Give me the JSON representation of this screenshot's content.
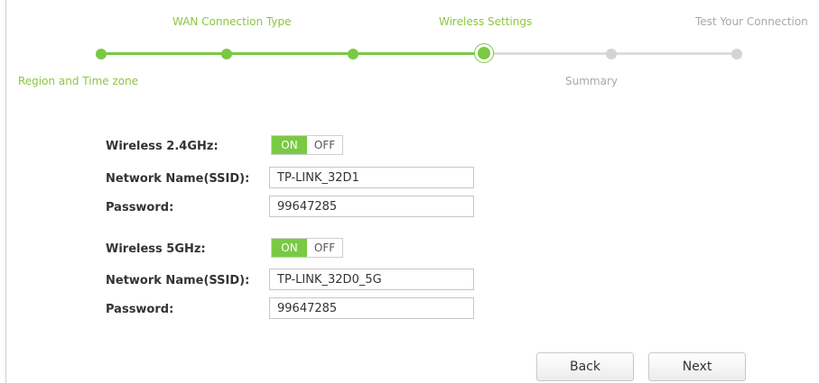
{
  "wizard": {
    "steps": [
      {
        "label": "Region and Time zone",
        "state": "done"
      },
      {
        "label": "WAN Connection Type",
        "state": "done"
      },
      {
        "label": "",
        "state": "done"
      },
      {
        "label": "Wireless Settings",
        "state": "current"
      },
      {
        "label": "Summary",
        "state": "todo"
      },
      {
        "label": "Test Your Connection",
        "state": "todo"
      }
    ],
    "colors": {
      "active": "#7ac943",
      "inactive": "#d4d4d4",
      "active_text": "#8cc63f",
      "inactive_text": "#a8a8a8"
    }
  },
  "wireless_24": {
    "label": "Wireless 2.4GHz:",
    "toggle": {
      "on_label": "ON",
      "off_label": "OFF",
      "value": "ON"
    },
    "ssid_label": "Network Name(SSID):",
    "ssid_value": "TP-LINK_32D1",
    "password_label": "Password:",
    "password_value": "99647285"
  },
  "wireless_5": {
    "label": "Wireless 5GHz:",
    "toggle": {
      "on_label": "ON",
      "off_label": "OFF",
      "value": "ON"
    },
    "ssid_label": "Network Name(SSID):",
    "ssid_value": "TP-LINK_32D0_5G",
    "password_label": "Password:",
    "password_value": "99647285"
  },
  "buttons": {
    "back": "Back",
    "next": "Next"
  }
}
